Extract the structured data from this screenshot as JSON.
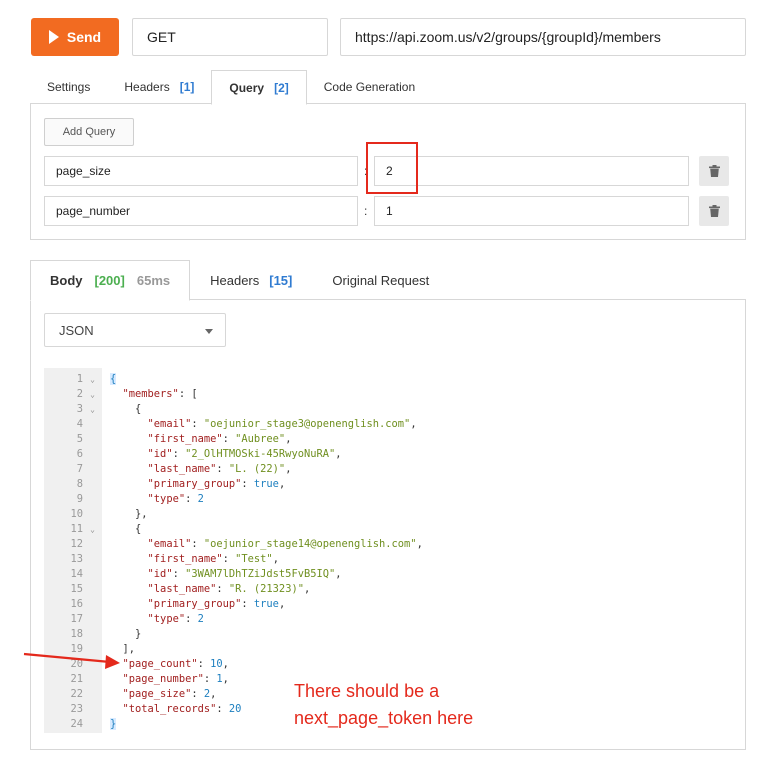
{
  "request": {
    "send_label": "Send",
    "method": "GET",
    "url": "https://api.zoom.us/v2/groups/{groupId}/members"
  },
  "request_tabs": [
    {
      "label": "Settings",
      "count": ""
    },
    {
      "label": "Headers",
      "count": "[1]"
    },
    {
      "label": "Query",
      "count": "[2]",
      "active": true
    },
    {
      "label": "Code Generation",
      "count": ""
    }
  ],
  "query": {
    "add_label": "Add Query",
    "params": [
      {
        "key": "page_size",
        "value": "2"
      },
      {
        "key": "page_number",
        "value": "1"
      }
    ]
  },
  "response_tabs": {
    "body": {
      "label": "Body",
      "status": "[200]",
      "time": "65ms"
    },
    "headers": {
      "label": "Headers",
      "count": "[15]"
    },
    "original": {
      "label": "Original Request"
    }
  },
  "format": {
    "selected": "JSON"
  },
  "code_lines": [
    {
      "n": "1",
      "fold": true,
      "tokens": [
        [
          "b",
          "{"
        ]
      ]
    },
    {
      "n": "2",
      "fold": true,
      "tokens": [
        [
          "p",
          "  "
        ],
        [
          "k",
          "\"members\""
        ],
        [
          "p",
          ": ["
        ]
      ]
    },
    {
      "n": "3",
      "fold": true,
      "tokens": [
        [
          "p",
          "    {"
        ]
      ]
    },
    {
      "n": "4",
      "fold": false,
      "tokens": [
        [
          "p",
          "      "
        ],
        [
          "k",
          "\"email\""
        ],
        [
          "p",
          ": "
        ],
        [
          "s",
          "\"oejunior_stage3@openenglish.com\""
        ],
        [
          "p",
          ","
        ]
      ]
    },
    {
      "n": "5",
      "fold": false,
      "tokens": [
        [
          "p",
          "      "
        ],
        [
          "k",
          "\"first_name\""
        ],
        [
          "p",
          ": "
        ],
        [
          "s",
          "\"Aubree\""
        ],
        [
          "p",
          ","
        ]
      ]
    },
    {
      "n": "6",
      "fold": false,
      "tokens": [
        [
          "p",
          "      "
        ],
        [
          "k",
          "\"id\""
        ],
        [
          "p",
          ": "
        ],
        [
          "s",
          "\"2_OlHTMOSki-45RwyoNuRA\""
        ],
        [
          "p",
          ","
        ]
      ]
    },
    {
      "n": "7",
      "fold": false,
      "tokens": [
        [
          "p",
          "      "
        ],
        [
          "k",
          "\"last_name\""
        ],
        [
          "p",
          ": "
        ],
        [
          "s",
          "\"L. (22)\""
        ],
        [
          "p",
          ","
        ]
      ]
    },
    {
      "n": "8",
      "fold": false,
      "tokens": [
        [
          "p",
          "      "
        ],
        [
          "k",
          "\"primary_group\""
        ],
        [
          "p",
          ": "
        ],
        [
          "n",
          "true"
        ],
        [
          "p",
          ","
        ]
      ]
    },
    {
      "n": "9",
      "fold": false,
      "tokens": [
        [
          "p",
          "      "
        ],
        [
          "k",
          "\"type\""
        ],
        [
          "p",
          ": "
        ],
        [
          "n",
          "2"
        ]
      ]
    },
    {
      "n": "10",
      "fold": false,
      "tokens": [
        [
          "p",
          "    },"
        ]
      ]
    },
    {
      "n": "11",
      "fold": true,
      "tokens": [
        [
          "p",
          "    {"
        ]
      ]
    },
    {
      "n": "12",
      "fold": false,
      "tokens": [
        [
          "p",
          "      "
        ],
        [
          "k",
          "\"email\""
        ],
        [
          "p",
          ": "
        ],
        [
          "s",
          "\"oejunior_stage14@openenglish.com\""
        ],
        [
          "p",
          ","
        ]
      ]
    },
    {
      "n": "13",
      "fold": false,
      "tokens": [
        [
          "p",
          "      "
        ],
        [
          "k",
          "\"first_name\""
        ],
        [
          "p",
          ": "
        ],
        [
          "s",
          "\"Test\""
        ],
        [
          "p",
          ","
        ]
      ]
    },
    {
      "n": "14",
      "fold": false,
      "tokens": [
        [
          "p",
          "      "
        ],
        [
          "k",
          "\"id\""
        ],
        [
          "p",
          ": "
        ],
        [
          "s",
          "\"3WAM7lDhTZiJdst5FvB5IQ\""
        ],
        [
          "p",
          ","
        ]
      ]
    },
    {
      "n": "15",
      "fold": false,
      "tokens": [
        [
          "p",
          "      "
        ],
        [
          "k",
          "\"last_name\""
        ],
        [
          "p",
          ": "
        ],
        [
          "s",
          "\"R. (21323)\""
        ],
        [
          "p",
          ","
        ]
      ]
    },
    {
      "n": "16",
      "fold": false,
      "tokens": [
        [
          "p",
          "      "
        ],
        [
          "k",
          "\"primary_group\""
        ],
        [
          "p",
          ": "
        ],
        [
          "n",
          "true"
        ],
        [
          "p",
          ","
        ]
      ]
    },
    {
      "n": "17",
      "fold": false,
      "tokens": [
        [
          "p",
          "      "
        ],
        [
          "k",
          "\"type\""
        ],
        [
          "p",
          ": "
        ],
        [
          "n",
          "2"
        ]
      ]
    },
    {
      "n": "18",
      "fold": false,
      "tokens": [
        [
          "p",
          "    }"
        ]
      ]
    },
    {
      "n": "19",
      "fold": false,
      "tokens": [
        [
          "p",
          "  ],"
        ]
      ]
    },
    {
      "n": "20",
      "fold": false,
      "tokens": [
        [
          "p",
          "  "
        ],
        [
          "k",
          "\"page_count\""
        ],
        [
          "p",
          ": "
        ],
        [
          "n",
          "10"
        ],
        [
          "p",
          ","
        ]
      ]
    },
    {
      "n": "21",
      "fold": false,
      "tokens": [
        [
          "p",
          "  "
        ],
        [
          "k",
          "\"page_number\""
        ],
        [
          "p",
          ": "
        ],
        [
          "n",
          "1"
        ],
        [
          "p",
          ","
        ]
      ]
    },
    {
      "n": "22",
      "fold": false,
      "tokens": [
        [
          "p",
          "  "
        ],
        [
          "k",
          "\"page_size\""
        ],
        [
          "p",
          ": "
        ],
        [
          "n",
          "2"
        ],
        [
          "p",
          ","
        ]
      ]
    },
    {
      "n": "23",
      "fold": false,
      "tokens": [
        [
          "p",
          "  "
        ],
        [
          "k",
          "\"total_records\""
        ],
        [
          "p",
          ": "
        ],
        [
          "n",
          "20"
        ]
      ]
    },
    {
      "n": "24",
      "fold": false,
      "tokens": [
        [
          "b",
          "}"
        ]
      ]
    }
  ],
  "annotation": {
    "text": "There should be a next_page_token here",
    "color": "#e4291c"
  },
  "colors": {
    "send": "#f26b21",
    "accent_blue": "#2f7bd1",
    "status_green": "#4caf50"
  }
}
